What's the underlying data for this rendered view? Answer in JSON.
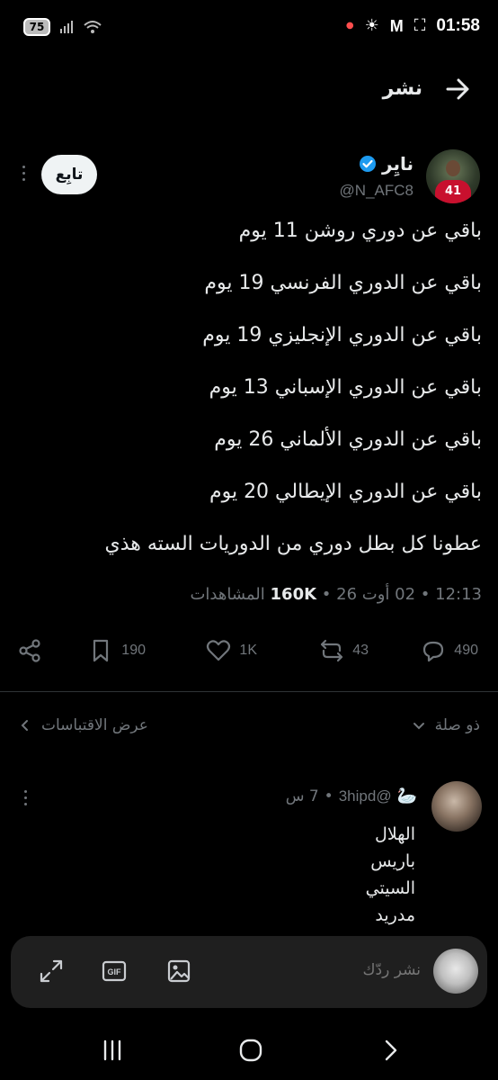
{
  "status_bar": {
    "battery": "75",
    "time": "01:58"
  },
  "header": {
    "title": "نشر"
  },
  "tweet": {
    "author_name": "نايِر",
    "author_handle": "@N_AFC8",
    "follow_label": "تابِع",
    "lines": [
      "باقي عن دوري روشن 11 يوم",
      "باقي عن الدوري الفرنسي 19 يوم",
      "باقي عن الدوري الإنجليزي 19 يوم",
      "باقي عن الدوري الإسباني 13 يوم",
      "باقي عن الدوري الألماني 26 يوم",
      "باقي عن الدوري الإيطالي 20 يوم",
      "عطونا كل بطل دوري من الدوريات السته هذي"
    ],
    "time": "12:13",
    "date": "02 أوت 26",
    "views_count": "160K",
    "views_label": "المشاهدات"
  },
  "actions": {
    "replies": "490",
    "reposts": "43",
    "likes": "1K",
    "bookmarks": "190"
  },
  "related": {
    "relevant_label": "ذو صلة",
    "quotes_label": "عرض الاقتباسات"
  },
  "reply": {
    "handle": "@3hipd",
    "time": "7 س",
    "lines": [
      "الهلال",
      "باريس",
      "السيتي",
      "مدريد"
    ]
  },
  "composer": {
    "placeholder": "نشر ردّك"
  },
  "colors": {
    "background": "#000000",
    "text": "#e7e9ea",
    "muted": "#71767b",
    "verified": "#1d9bf0",
    "divider": "#2f3336"
  }
}
